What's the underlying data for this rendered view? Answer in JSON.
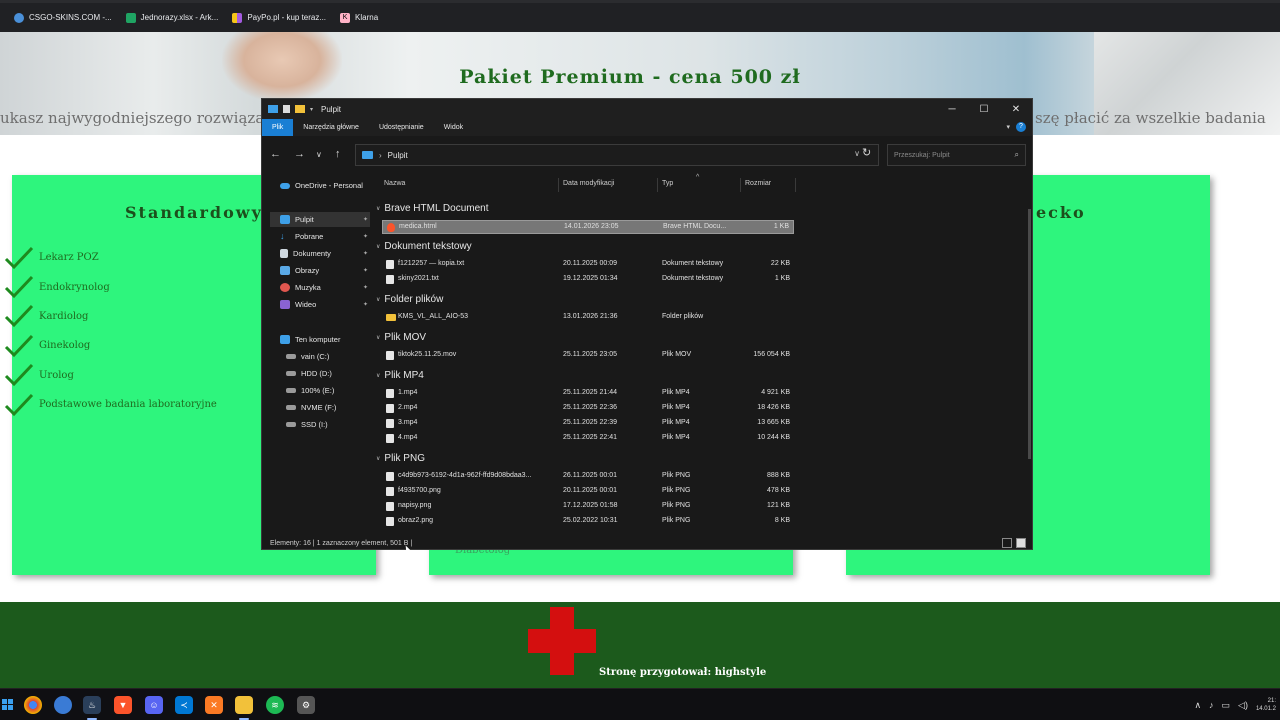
{
  "bookmarks": [
    {
      "label": "CSGO-SKINS.COM -...",
      "icon": "csgo-icon",
      "color": "#4a90d9"
    },
    {
      "label": "Jednorazy.xlsx - Ark...",
      "icon": "sheets-icon",
      "color": "#1fa463"
    },
    {
      "label": "PayPo.pl - kup teraz...",
      "icon": "paypo-icon",
      "color": "#f5c518"
    },
    {
      "label": "Klarna",
      "icon": "klarna-icon",
      "color": "#ffb3c7"
    }
  ],
  "website": {
    "hero_title": "Pakiet Premium - cena 500 zł",
    "hero_text_left": "ukasz najwygodniejszego rozwiązan",
    "hero_text_right": "szę płacić za wszelkie badania",
    "card1_title": "Standardowy",
    "card3_title": "ecko",
    "card1_items": [
      "Lekarz POZ",
      "Endokrynolog",
      "Kardiolog",
      "Ginekolog",
      "Urolog",
      "Podstawowe badania laboratoryjne"
    ],
    "card2_faint": "Diabetolog",
    "footer_text": "Stronę przygotował: highstyle",
    "accent_green": "#2ef57d",
    "dark_green": "#1c5a1c"
  },
  "explorer": {
    "title": "Pulpit",
    "ribbon_tabs": [
      "Plik",
      "Narzędzia główne",
      "Udostępnianie",
      "Widok"
    ],
    "address": "Pulpit",
    "search_placeholder": "Przeszukaj: Pulpit",
    "columns": {
      "name": "Nazwa",
      "date": "Data modyfikacji",
      "type": "Typ",
      "size": "Rozmiar"
    },
    "nav_items": [
      {
        "label": "OneDrive - Personal",
        "icon": "onedrive-icon"
      },
      {
        "label": "Pulpit",
        "icon": "desktop-icon"
      },
      {
        "label": "Pobrane",
        "icon": "downloads-icon"
      },
      {
        "label": "Dokumenty",
        "icon": "documents-icon"
      },
      {
        "label": "Obrazy",
        "icon": "pictures-icon"
      },
      {
        "label": "Muzyka",
        "icon": "music-icon"
      },
      {
        "label": "Wideo",
        "icon": "video-icon"
      },
      {
        "label": "Ten komputer",
        "icon": "this-pc-icon"
      },
      {
        "label": "vain (C:)",
        "icon": "drive-icon"
      },
      {
        "label": "HDD (D:)",
        "icon": "drive-icon"
      },
      {
        "label": "100% (E:)",
        "icon": "drive-icon"
      },
      {
        "label": "NVME (F:)",
        "icon": "drive-icon"
      },
      {
        "label": "SSD (I:)",
        "icon": "drive-icon"
      }
    ],
    "groups": [
      {
        "label": "Brave HTML Document",
        "files": [
          {
            "name": "medica.html",
            "date": "14.01.2026 23:05",
            "type": "Brave HTML Docu...",
            "size": "1 KB",
            "selected": true
          }
        ]
      },
      {
        "label": "Dokument tekstowy",
        "files": [
          {
            "name": "f1212257 — kopia.txt",
            "date": "20.11.2025 00:09",
            "type": "Dokument tekstowy",
            "size": "22 KB"
          },
          {
            "name": "skiny2021.txt",
            "date": "19.12.2025 01:34",
            "type": "Dokument tekstowy",
            "size": "1 KB"
          }
        ]
      },
      {
        "label": "Folder plików",
        "files": [
          {
            "name": "KMS_VL_ALL_AIO-53",
            "date": "13.01.2026 21:36",
            "type": "Folder plików",
            "size": ""
          }
        ]
      },
      {
        "label": "Plik MOV",
        "files": [
          {
            "name": "tiktok25.11.25.mov",
            "date": "25.11.2025 23:05",
            "type": "Plik MOV",
            "size": "156 054 KB"
          }
        ]
      },
      {
        "label": "Plik MP4",
        "files": [
          {
            "name": "1.mp4",
            "date": "25.11.2025 21:44",
            "type": "Plik MP4",
            "size": "4 921 KB"
          },
          {
            "name": "2.mp4",
            "date": "25.11.2025 22:36",
            "type": "Plik MP4",
            "size": "18 426 KB"
          },
          {
            "name": "3.mp4",
            "date": "25.11.2025 22:39",
            "type": "Plik MP4",
            "size": "13 665 KB"
          },
          {
            "name": "4.mp4",
            "date": "25.11.2025 22:41",
            "type": "Plik MP4",
            "size": "10 244 KB"
          }
        ]
      },
      {
        "label": "Plik PNG",
        "files": [
          {
            "name": "c4d9b973-6192-4d1a-962f-ffd9d08bdaa3...",
            "date": "26.11.2025 00:01",
            "type": "Plik PNG",
            "size": "888 KB"
          },
          {
            "name": "f4935700.png",
            "date": "20.11.2025 00:01",
            "type": "Plik PNG",
            "size": "478 KB"
          },
          {
            "name": "napisy.png",
            "date": "17.12.2025 01:58",
            "type": "Plik PNG",
            "size": "121 KB"
          },
          {
            "name": "obraz2.png",
            "date": "25.02.2022 10:31",
            "type": "Plik PNG",
            "size": "8 KB"
          }
        ]
      }
    ],
    "status": "Elementy: 16   |   1 zaznaczony element, 501 B   |"
  },
  "taskbar": {
    "apps": [
      {
        "icon": "chrome-icon",
        "color": "#db4437"
      },
      {
        "icon": "edge-icon",
        "color": "#3a7bd5"
      },
      {
        "icon": "steam-icon",
        "color": "#1b2838"
      },
      {
        "icon": "brave-icon",
        "color": "#fb542b"
      },
      {
        "icon": "discord-icon",
        "color": "#5865f2"
      },
      {
        "icon": "vscode-icon",
        "color": "#0078d4"
      },
      {
        "icon": "xampp-icon",
        "color": "#fb7a24"
      },
      {
        "icon": "file-explorer-icon",
        "color": "#f2c13a"
      },
      {
        "icon": "spotify-icon",
        "color": "#1db954"
      },
      {
        "icon": "game-icon",
        "color": "#666666"
      }
    ],
    "time": "21:",
    "date": "14.01.2"
  }
}
